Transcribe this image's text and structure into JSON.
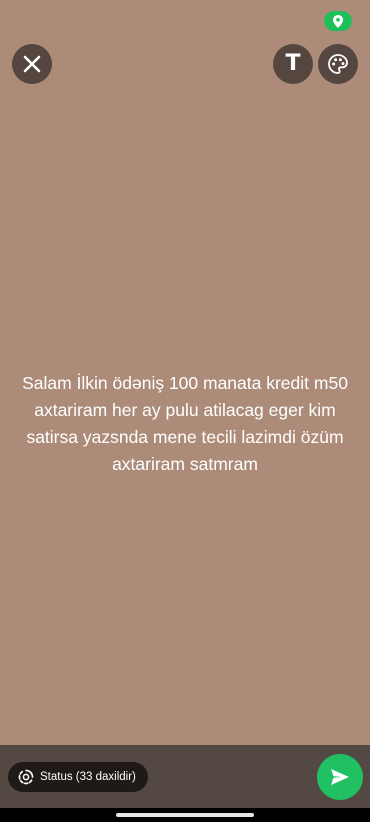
{
  "status": {
    "message": "Salam İlkin ödəniş 100 manata kredit m50 axtariram her ay pulu atilacag eger kim satirsa yazsnda mene tecili lazimdi özüm axtariram satmram",
    "background_color": "#ad8b79"
  },
  "top_bar": {
    "close_icon": "close-icon",
    "text_tool_glyph": "T",
    "palette_icon": "palette-icon",
    "location_icon": "location-pin-icon"
  },
  "bottom_bar": {
    "audience_label": "Status (33 daxildir)",
    "audience_icon": "status-ring-icon",
    "send_icon": "send-icon"
  },
  "colors": {
    "accent_green": "#21c063",
    "button_background": "#55473f",
    "bottom_bar": "#544942"
  }
}
